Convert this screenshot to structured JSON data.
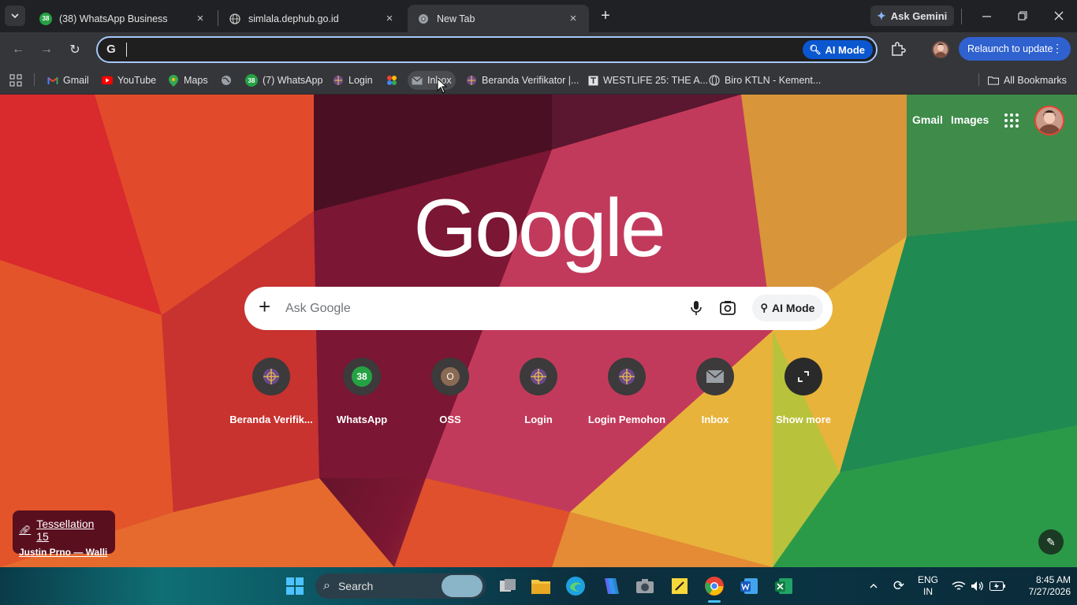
{
  "browser": {
    "tabs": [
      {
        "title": "(38) WhatsApp Business",
        "badge": "38",
        "favicon": "whatsapp-icon",
        "active": false
      },
      {
        "title": "simlala.dephub.go.id",
        "favicon": "globe-icon",
        "active": false
      },
      {
        "title": "New Tab",
        "favicon": "chrome-icon",
        "active": true
      }
    ],
    "ask_gemini": "Ask Gemini",
    "omnibox": {
      "value": "",
      "placeholder": "",
      "ai_mode": "AI Mode"
    },
    "relaunch": "Relaunch to update",
    "bookmarks": [
      {
        "label": "Gmail",
        "icon": "gmail-icon"
      },
      {
        "label": "YouTube",
        "icon": "youtube-icon"
      },
      {
        "label": "Maps",
        "icon": "maps-icon"
      },
      {
        "label": "",
        "icon": "globe-icon"
      },
      {
        "label": "(7) WhatsApp",
        "icon": "whatsapp-icon",
        "badge": "38"
      },
      {
        "label": "Login",
        "icon": "globe-icon"
      },
      {
        "label": "",
        "icon": "photos-icon"
      },
      {
        "label": "Inbox",
        "icon": "mail-icon"
      },
      {
        "label": "Beranda Verifikator |...",
        "icon": "globe-icon"
      },
      {
        "label": "WESTLIFE 25: THE A...",
        "icon": "document-icon"
      },
      {
        "label": "Biro KTLN - Kement...",
        "icon": "globe-icon"
      }
    ],
    "all_bookmarks": "All Bookmarks"
  },
  "ntp": {
    "top_links": {
      "gmail": "Gmail",
      "images": "Images"
    },
    "logo": "Google",
    "search": {
      "placeholder": "Ask Google",
      "ai_mode": "AI Mode"
    },
    "shortcuts": [
      {
        "label": "Beranda Verifik...",
        "icon": "globe-icon"
      },
      {
        "label": "WhatsApp",
        "icon": "whatsapp-icon",
        "badge": "38"
      },
      {
        "label": "OSS",
        "icon": "letter-o-icon",
        "letter": "O"
      },
      {
        "label": "Login",
        "icon": "globe-icon"
      },
      {
        "label": "Login Pemohon",
        "icon": "globe-icon"
      },
      {
        "label": "Inbox",
        "icon": "mail-icon"
      },
      {
        "label": "Show more",
        "icon": "expand-icon"
      }
    ],
    "attribution": {
      "title": "Tessellation 15",
      "author": "Justin Prno — Walli"
    }
  },
  "taskbar": {
    "search_placeholder": "Search",
    "language": {
      "line1": "ENG",
      "line2": "IN"
    },
    "time": "8:45 AM",
    "date": "7/27/2026"
  },
  "colors": {
    "accent": "#a8c7fa",
    "relaunch": "#2f61cf",
    "whatsapp": "#25a244",
    "tab_bar": "#202124",
    "toolbar": "#35363a"
  }
}
